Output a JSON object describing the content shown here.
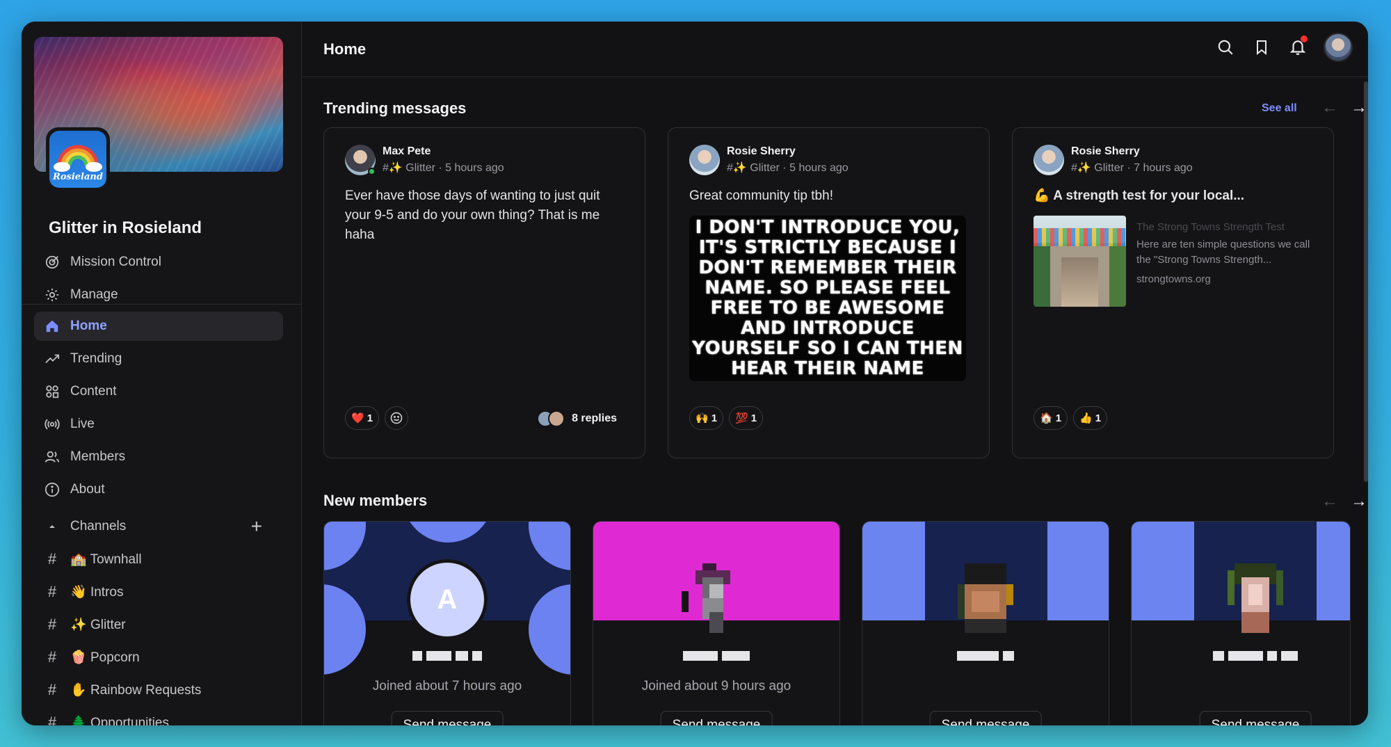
{
  "sidebar": {
    "community_name": "Glitter in Rosieland",
    "top_items": [
      {
        "label": "Mission Control",
        "icon": "target-icon"
      },
      {
        "label": "Manage",
        "icon": "gear-icon"
      }
    ],
    "nav_items": [
      {
        "label": "Home",
        "icon": "home-icon",
        "active": true
      },
      {
        "label": "Trending",
        "icon": "trending-icon"
      },
      {
        "label": "Content",
        "icon": "content-icon"
      },
      {
        "label": "Live",
        "icon": "live-icon"
      },
      {
        "label": "Members",
        "icon": "members-icon"
      },
      {
        "label": "About",
        "icon": "info-icon"
      }
    ],
    "channels_label": "Channels",
    "channels": [
      {
        "emoji": "🏫",
        "name": "Townhall"
      },
      {
        "emoji": "👋",
        "name": "Intros"
      },
      {
        "emoji": "✨",
        "name": "Glitter"
      },
      {
        "emoji": "🍿",
        "name": "Popcorn"
      },
      {
        "emoji": "✋",
        "name": "Rainbow Requests"
      },
      {
        "emoji": "🌲",
        "name": "Opportunities"
      }
    ]
  },
  "topbar": {
    "title": "Home"
  },
  "trending": {
    "title": "Trending messages",
    "see_all": "See all",
    "posts": [
      {
        "author": "Max Pete",
        "meta": "#✨ Glitter · 5 hours ago",
        "body": "Ever have those days of wanting to just quit your 9-5 and do your own thing? That is me haha",
        "reactions": [
          {
            "emoji": "❤️",
            "count": "1"
          }
        ],
        "replies": "8 replies"
      },
      {
        "author": "Rosie Sherry",
        "meta": "#✨ Glitter · 5 hours ago",
        "body": "Great community tip tbh!",
        "meme_text": "I DON'T INTRODUCE YOU, IT'S STRICTLY BECAUSE I DON'T REMEMBER THEIR NAME. SO PLEASE FEEL FREE TO BE AWESOME AND INTRODUCE YOURSELF SO I CAN THEN HEAR THEIR NAME",
        "reactions": [
          {
            "emoji": "🙌",
            "count": "1"
          },
          {
            "emoji": "💯",
            "count": "1"
          }
        ]
      },
      {
        "author": "Rosie Sherry",
        "meta": "#✨ Glitter · 7 hours ago",
        "body": "💪 A strength test for your local...",
        "link": {
          "title": "The Strong Towns Strength Test",
          "description": "Here are ten simple questions we call the \"Strong Towns Strength...",
          "domain": "strongtowns.org"
        },
        "reactions": [
          {
            "emoji": "🏠",
            "count": "1"
          },
          {
            "emoji": "👍",
            "count": "1"
          }
        ]
      }
    ]
  },
  "new_members": {
    "title": "New members",
    "members": [
      {
        "initial": "A",
        "joined": "Joined about 7 hours ago",
        "button": "Send message"
      },
      {
        "initial": "",
        "joined": "Joined about 9 hours ago",
        "button": "Send message"
      },
      {
        "initial": "",
        "joined": "",
        "button": "Send message"
      },
      {
        "initial": "",
        "joined": "",
        "button": "Send message"
      }
    ]
  },
  "colors": {
    "accent": "#7c8dff",
    "background": "#121214",
    "navy_cover": "#17224f",
    "magenta_cover": "#df2ad3",
    "periwinkle_cover": "#6b84f0"
  }
}
